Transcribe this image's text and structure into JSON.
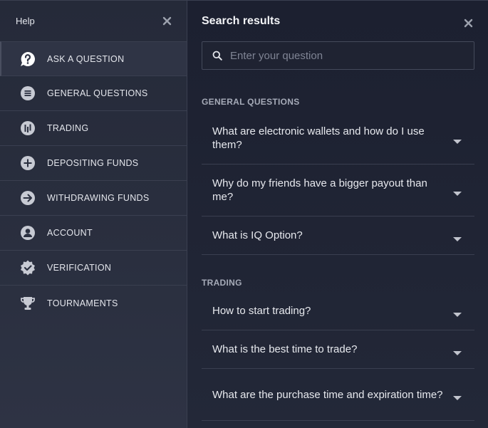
{
  "sidebar": {
    "title": "Help",
    "items": [
      {
        "label": "ASK A QUESTION",
        "icon": "question-circle-icon",
        "active": true
      },
      {
        "label": "GENERAL QUESTIONS",
        "icon": "list-icon"
      },
      {
        "label": "TRADING",
        "icon": "chart-bars-icon"
      },
      {
        "label": "DEPOSITING FUNDS",
        "icon": "plus-circle-icon"
      },
      {
        "label": "WITHDRAWING FUNDS",
        "icon": "arrow-right-circle-icon"
      },
      {
        "label": "ACCOUNT",
        "icon": "user-circle-icon"
      },
      {
        "label": "VERIFICATION",
        "icon": "badge-check-icon"
      },
      {
        "label": "TOURNAMENTS",
        "icon": "trophy-icon"
      }
    ]
  },
  "main": {
    "title": "Search results",
    "search_placeholder": "Enter your question",
    "sections": [
      {
        "title": "GENERAL QUESTIONS",
        "items": [
          "What are electronic wallets and how do I use them?",
          "Why do my friends have a bigger payout than me?",
          "What is IQ Option?"
        ]
      },
      {
        "title": "TRADING",
        "items": [
          "How to start trading?",
          "What is the best time to trade?",
          "What are the purchase time and expiration time?"
        ]
      }
    ]
  },
  "colors": {
    "background": "#1a1e2b",
    "sidebar": "#2a2f3f",
    "divider": "#3a3f50",
    "text": "#e7e9ee",
    "muted": "#a6abb8"
  }
}
